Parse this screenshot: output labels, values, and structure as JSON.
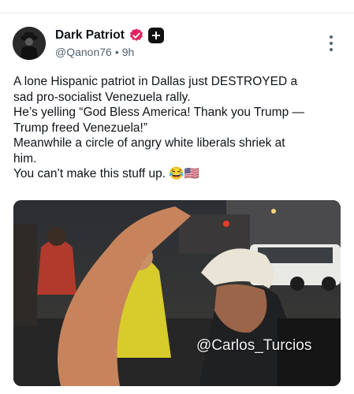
{
  "post": {
    "author_name": "Dark Patriot",
    "handle": "@Qanon76",
    "separator": "•",
    "time": "9h",
    "body_lines": [
      "A lone Hispanic patriot in Dallas just DESTROYED a",
      "sad pro-socialist Venezuela rally.",
      "He’s yelling “God Bless America! Thank you Trump —",
      "Trump freed Venezuela!”",
      "Meanwhile a circle of angry white liberals shriek at",
      "him.",
      "You can’t make this stuff up. 😂🇺🇸"
    ],
    "video_watermark": "@Carlos_Turcios",
    "video_progress": 0.34
  },
  "icons": {
    "verified": "verified-badge-icon",
    "plus": "plus-badge-icon",
    "more": "more-options-icon"
  },
  "colors": {
    "verified_pink": "#e0245e",
    "muted_text": "#536471"
  }
}
